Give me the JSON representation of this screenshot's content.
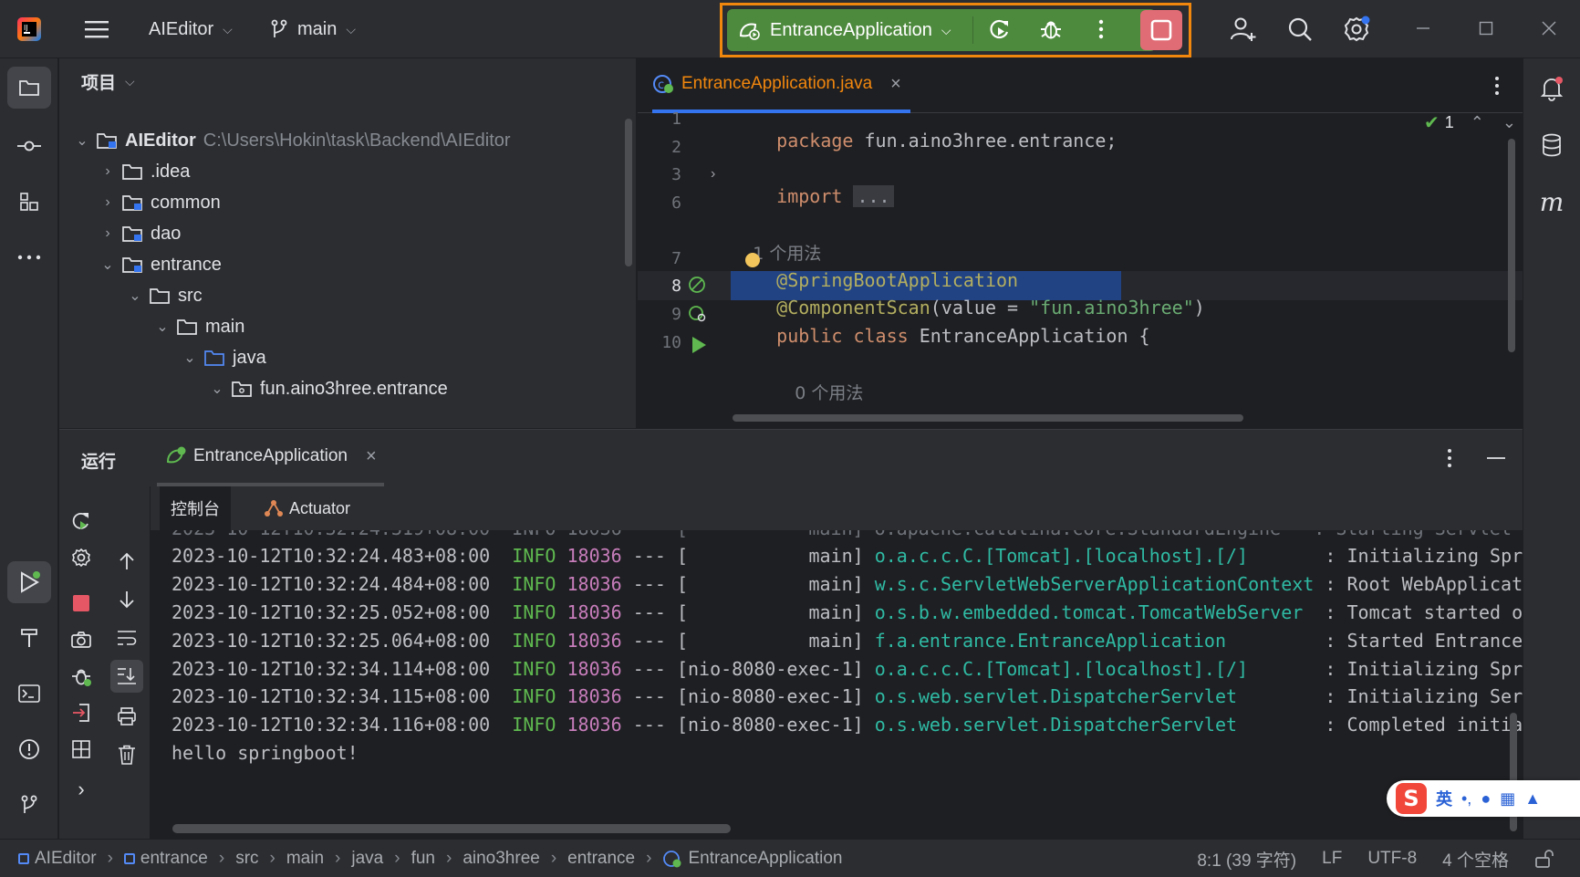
{
  "titlebar": {
    "project_name": "AIEditor",
    "branch": "main",
    "run_config": "EntranceApplication"
  },
  "project_panel": {
    "title": "项目",
    "tree": [
      {
        "name": "AIEditor",
        "path": "C:\\Users\\Hokin\\task\\Backend\\AIEditor",
        "expanded": true
      },
      {
        "name": ".idea",
        "expanded": false
      },
      {
        "name": "common",
        "expanded": false
      },
      {
        "name": "dao",
        "expanded": false
      },
      {
        "name": "entrance",
        "expanded": true
      },
      {
        "name": "src",
        "expanded": true
      },
      {
        "name": "main",
        "expanded": true
      },
      {
        "name": "java",
        "expanded": true
      },
      {
        "name": "fun.aino3hree.entrance",
        "expanded": true
      }
    ]
  },
  "editor": {
    "tab_label": "EntranceApplication.java",
    "inspection_count": "1",
    "line_numbers": [
      "1",
      "2",
      "3",
      "6",
      "",
      "7",
      "8",
      "9",
      "10",
      ""
    ],
    "lines": {
      "l1_kw": "package",
      "l1_rest": " fun.aino3hree.entrance;",
      "l3_kw": "import",
      "l3_fold": "...",
      "usage_hint_1": "1 个用法",
      "l7_ann": "@SpringBootApplication",
      "l8_ann": "@ComponentScan",
      "l8_args": "(value = ",
      "l8_str": "\"fun.aino3hree\"",
      "l8_close": ")",
      "l9_kw": "public class",
      "l9_rest": " EntranceApplication {",
      "usage_hint_0": "0 个用法"
    }
  },
  "run_panel": {
    "title": "运行",
    "tab_label": "EntranceApplication",
    "subtab_console": "控制台",
    "subtab_actuator": "Actuator",
    "log": [
      {
        "ts": "2023-10-12T10:32:24.483+08:00",
        "level": "INFO",
        "pid": "18036",
        "sep": "---",
        "thread": "[           main]",
        "logger": "o.a.c.c.C.[Tomcat].[localhost].[/]",
        "msg": ": Initializing Spri"
      },
      {
        "ts": "2023-10-12T10:32:24.484+08:00",
        "level": "INFO",
        "pid": "18036",
        "sep": "---",
        "thread": "[           main]",
        "logger": "w.s.c.ServletWebServerApplicationContext",
        "msg": ": Root WebApplicat:"
      },
      {
        "ts": "2023-10-12T10:32:25.052+08:00",
        "level": "INFO",
        "pid": "18036",
        "sep": "---",
        "thread": "[           main]",
        "logger": "o.s.b.w.embedded.tomcat.TomcatWebServer",
        "msg": ": Tomcat started o"
      },
      {
        "ts": "2023-10-12T10:32:25.064+08:00",
        "level": "INFO",
        "pid": "18036",
        "sep": "---",
        "thread": "[           main]",
        "logger": "f.a.entrance.EntranceApplication",
        "msg": ": Started Entrance"
      },
      {
        "ts": "2023-10-12T10:32:34.114+08:00",
        "level": "INFO",
        "pid": "18036",
        "sep": "---",
        "thread": "[nio-8080-exec-1]",
        "logger": "o.a.c.c.C.[Tomcat].[localhost].[/]",
        "msg": ": Initializing Spri"
      },
      {
        "ts": "2023-10-12T10:32:34.115+08:00",
        "level": "INFO",
        "pid": "18036",
        "sep": "---",
        "thread": "[nio-8080-exec-1]",
        "logger": "o.s.web.servlet.DispatcherServlet",
        "msg": ": Initializing Ser"
      },
      {
        "ts": "2023-10-12T10:32:34.116+08:00",
        "level": "INFO",
        "pid": "18036",
        "sep": "---",
        "thread": "[nio-8080-exec-1]",
        "logger": "o.s.web.servlet.DispatcherServlet",
        "msg": ": Completed initia"
      }
    ],
    "output": "hello springboot!"
  },
  "statusbar": {
    "breadcrumbs": [
      "AIEditor",
      "entrance",
      "src",
      "main",
      "java",
      "fun",
      "aino3hree",
      "entrance",
      "EntranceApplication"
    ],
    "cursor": "8:1 (39 字符)",
    "line_sep": "LF",
    "encoding": "UTF-8",
    "indent": "4 个空格"
  },
  "ime": {
    "mode": "英"
  },
  "colors": {
    "accent_orange": "#f2870e",
    "run_green": "#4e8a3e",
    "stop_red": "#e06c75"
  }
}
